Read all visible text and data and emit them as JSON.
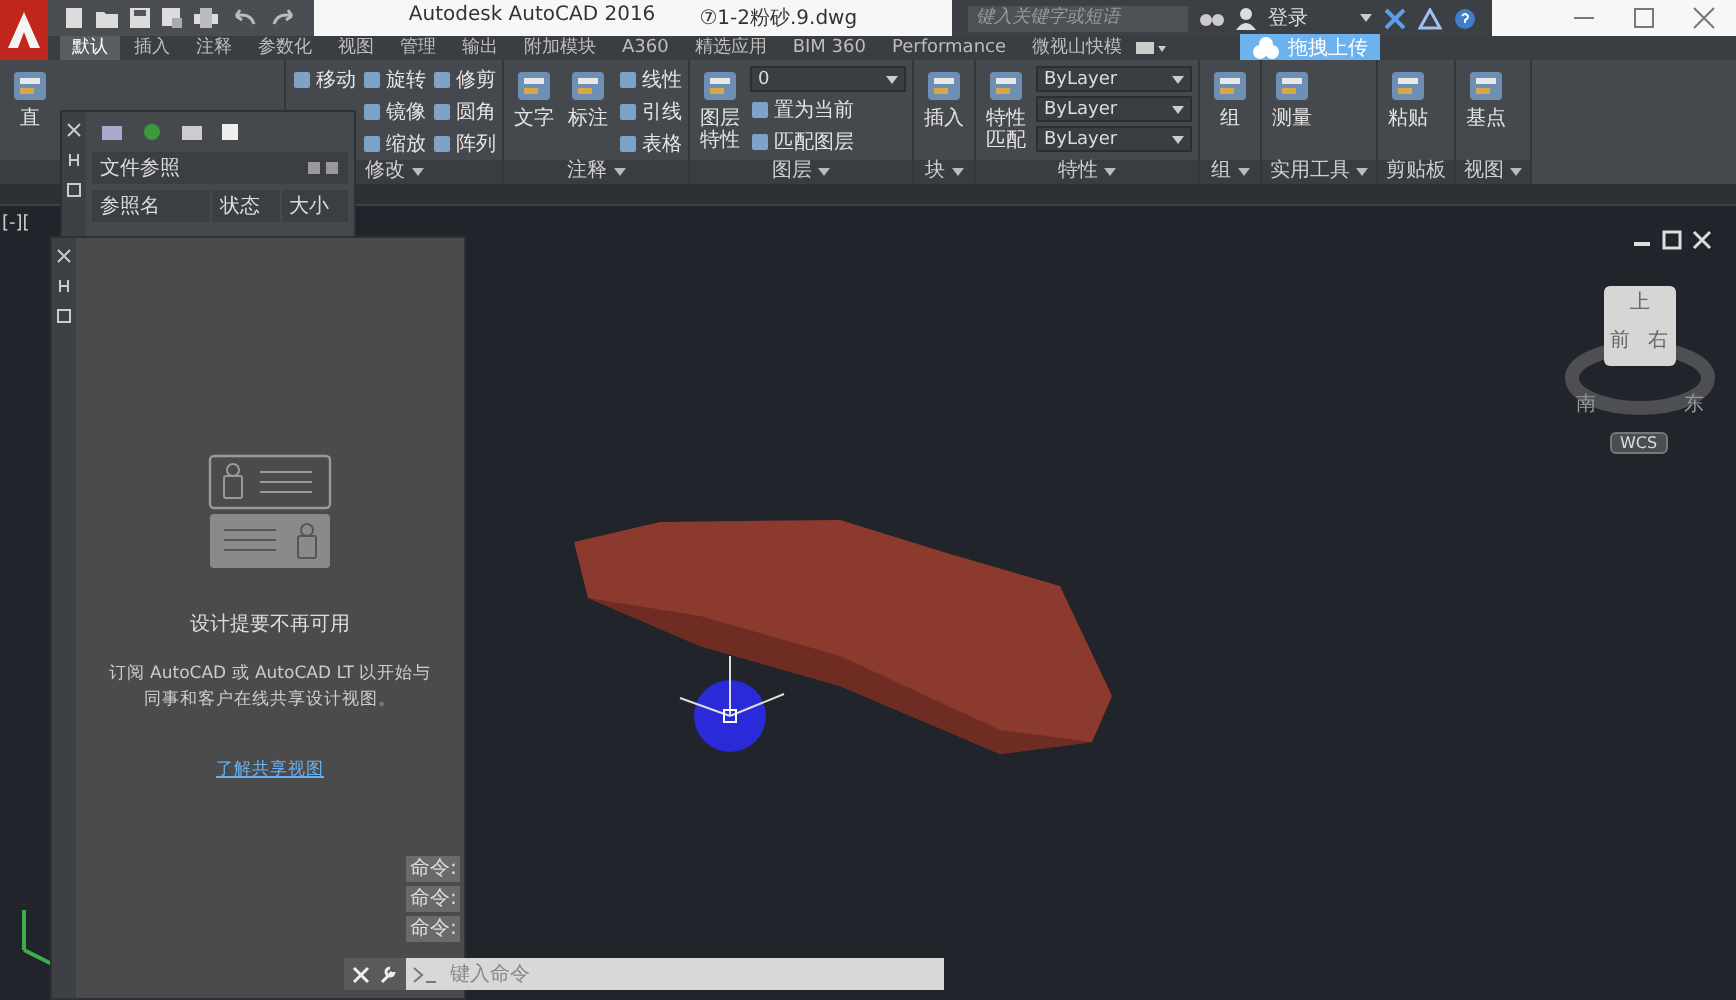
{
  "title_bar": {
    "title": "Autodesk AutoCAD 2016",
    "file_name": "⑦1-2粉砂.9.dwg",
    "search": {
      "placeholder": "键入关键字或短语"
    },
    "sign_in": "登录",
    "upload_badge": "拖拽上传"
  },
  "tabs": [
    {
      "label": "默认",
      "selected": true
    },
    {
      "label": "插入",
      "selected": false
    },
    {
      "label": "注释",
      "selected": false
    },
    {
      "label": "参数化",
      "selected": false
    },
    {
      "label": "视图",
      "selected": false
    },
    {
      "label": "管理",
      "selected": false
    },
    {
      "label": "输出",
      "selected": false
    },
    {
      "label": "附加模块",
      "selected": false
    },
    {
      "label": "A360",
      "selected": false
    },
    {
      "label": "精选应用",
      "selected": false
    },
    {
      "label": "BIM 360",
      "selected": false
    },
    {
      "label": "Performance",
      "selected": false
    },
    {
      "label": "微视山快模",
      "selected": false
    }
  ],
  "ribbon": {
    "panels": [
      {
        "groups": [
          {
            "kind": "large",
            "label": "直"
          }
        ]
      },
      {
        "title": "修改",
        "has_menu": true,
        "groups": [
          {
            "kind": "column",
            "items": [
              {
                "kind": "tool",
                "label": "移动"
              }
            ]
          },
          {
            "kind": "column",
            "items": [
              {
                "kind": "tool",
                "label": "旋转"
              },
              {
                "kind": "tool",
                "label": "镜像"
              },
              {
                "kind": "tool",
                "label": "缩放"
              }
            ]
          },
          {
            "kind": "column",
            "items": [
              {
                "kind": "tool",
                "label": "修剪"
              },
              {
                "kind": "tool",
                "label": "圆角"
              },
              {
                "kind": "tool",
                "label": "阵列"
              }
            ]
          }
        ]
      },
      {
        "title": "注释",
        "has_menu": true,
        "groups": [
          {
            "kind": "large",
            "label": "文字"
          },
          {
            "kind": "large",
            "label": "标注"
          },
          {
            "kind": "column",
            "items": [
              {
                "kind": "tool",
                "label": "线性"
              },
              {
                "kind": "tool",
                "label": "引线"
              },
              {
                "kind": "tool",
                "label": "表格"
              }
            ]
          }
        ]
      },
      {
        "title": "图层",
        "has_menu": true,
        "groups": [
          {
            "kind": "large",
            "label": "图层特性"
          },
          {
            "kind": "column",
            "items": [
              {
                "kind": "select",
                "value": "0"
              },
              {
                "kind": "tool",
                "label": "置为当前"
              },
              {
                "kind": "tool",
                "label": "匹配图层"
              }
            ]
          }
        ]
      },
      {
        "title": "块",
        "has_menu": true,
        "groups": [
          {
            "kind": "large",
            "label": "插入"
          }
        ]
      },
      {
        "title": "特性",
        "has_menu": true,
        "groups": [
          {
            "kind": "large",
            "label": "特性匹配"
          },
          {
            "kind": "column",
            "items": [
              {
                "kind": "select",
                "value": "ByLayer"
              },
              {
                "kind": "select",
                "value": "ByLayer"
              },
              {
                "kind": "select",
                "value": "ByLayer"
              }
            ]
          }
        ]
      },
      {
        "title": "组",
        "has_menu": true,
        "groups": [
          {
            "kind": "large",
            "label": "组"
          }
        ]
      },
      {
        "title": "实用工具",
        "has_menu": true,
        "groups": [
          {
            "kind": "large",
            "label": "测量"
          }
        ]
      },
      {
        "title": "剪贴板",
        "has_menu": false,
        "groups": [
          {
            "kind": "large",
            "label": "粘贴"
          }
        ]
      },
      {
        "title": "视图",
        "has_menu": true,
        "groups": [
          {
            "kind": "large",
            "label": "基点"
          }
        ]
      }
    ]
  },
  "viewport_label": "[-][",
  "xref_palette": {
    "title": "文件参照",
    "columns": [
      "参照名",
      "状态",
      "大小"
    ]
  },
  "design_feed": {
    "title": "设计提要不再可用",
    "message": "订阅 AutoCAD 或 AutoCAD LT 以开始与同事和客户在线共享设计视图。",
    "link": "了解共享视图"
  },
  "viewcube": {
    "faces": [
      "上",
      "前",
      "右"
    ],
    "compass": [
      "南",
      "东"
    ],
    "coordinate_system": "WCS"
  },
  "command_line": {
    "history": [
      "命令:",
      "命令:",
      "命令:"
    ],
    "placeholder": "键入命令"
  }
}
